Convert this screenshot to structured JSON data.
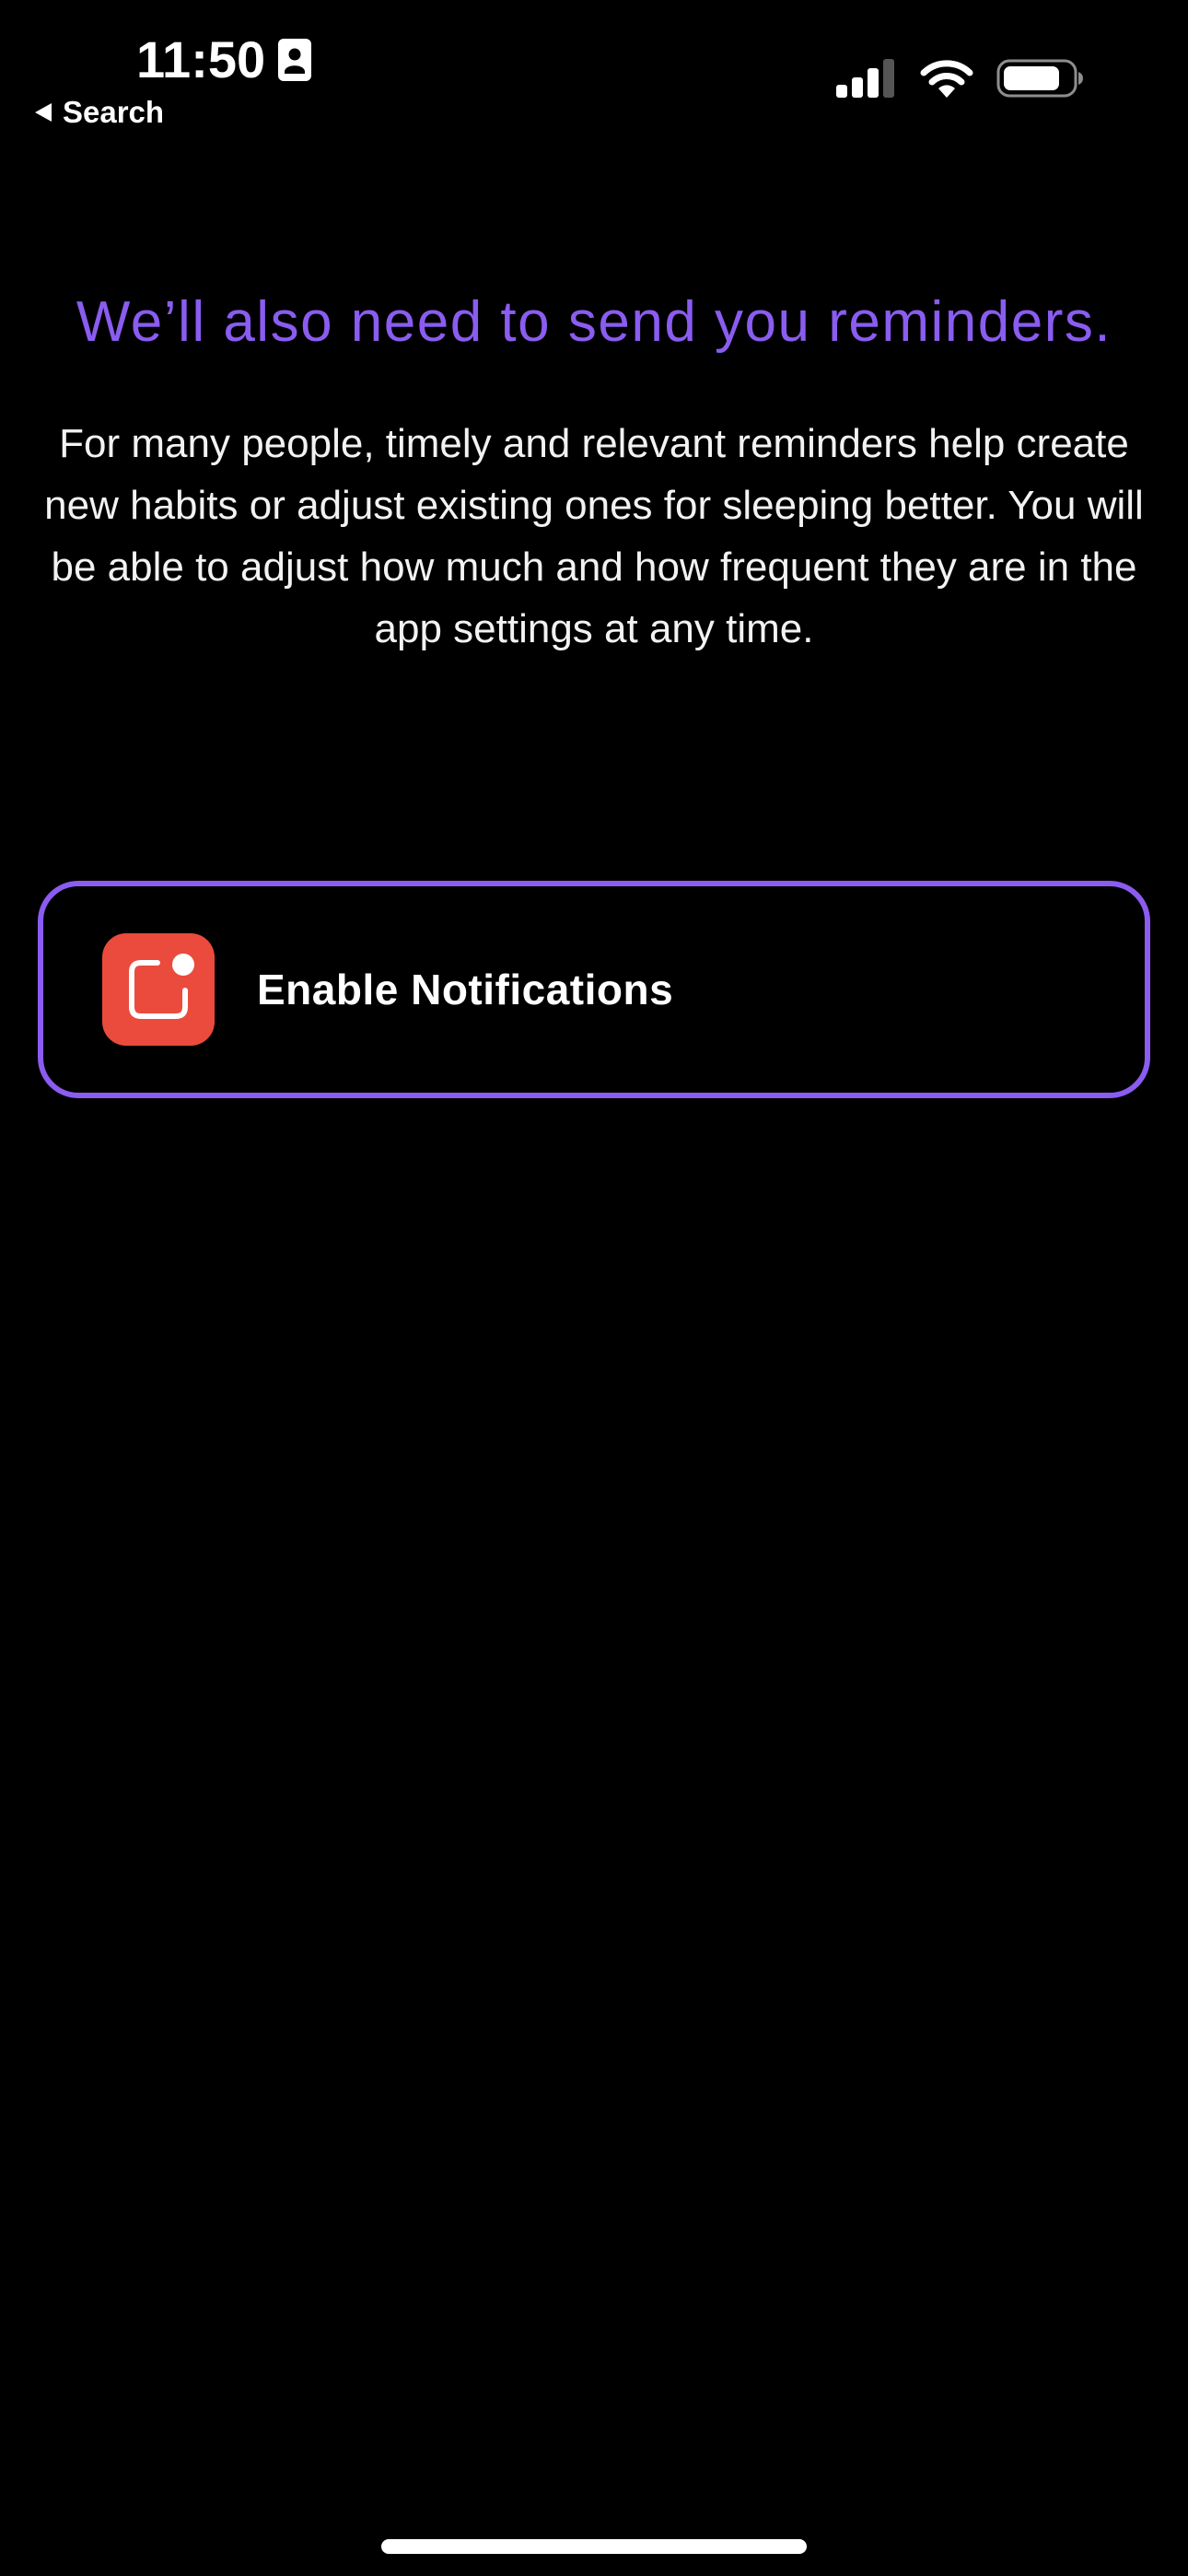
{
  "status_bar": {
    "time": "11:50",
    "back_label": "Search",
    "icons": [
      "contact-card-icon",
      "cellular-signal-icon",
      "wifi-icon",
      "battery-icon"
    ]
  },
  "main": {
    "headline": "We’ll also need to send you reminders.",
    "body": "For many people, timely and relevant reminders help create new habits or adjust existing ones for sleeping better. You will be able to adjust how much and how frequent they are in the app settings at any time.",
    "enable_button": {
      "label": "Enable Notifications",
      "icon": "app-notification-icon"
    }
  },
  "colors": {
    "accent": "#8a5cf0",
    "background": "#000000",
    "notification_icon_bg": "#ea4b3c",
    "text": "#ffffff"
  }
}
